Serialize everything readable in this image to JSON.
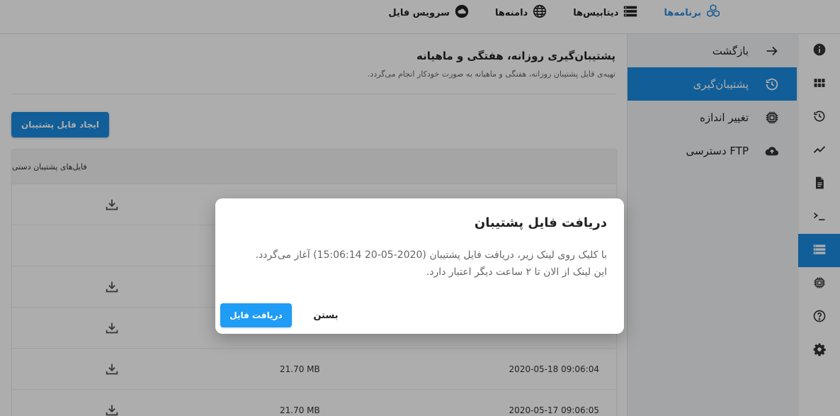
{
  "colors": {
    "accent": "#1a8be0",
    "dialog_button": "#1f9cf5",
    "overlay": "rgba(0,0,0,0.32)"
  },
  "topnav": {
    "items": [
      {
        "label": "برنامه‌ها",
        "icon": "cubes-icon",
        "active": true
      },
      {
        "label": "دیتابیس‌ها",
        "icon": "server-icon",
        "active": false
      },
      {
        "label": "دامنه‌ها",
        "icon": "globe-icon",
        "active": false
      },
      {
        "label": "سرویس فایل",
        "icon": "cloud-icon",
        "active": false
      }
    ]
  },
  "iconbar": {
    "items": [
      {
        "icon": "info-icon"
      },
      {
        "icon": "grid-icon"
      },
      {
        "icon": "history-icon"
      },
      {
        "icon": "chart-line-icon"
      },
      {
        "icon": "file-icon"
      },
      {
        "icon": "terminal-icon"
      },
      {
        "icon": "storage-icon",
        "active": true
      },
      {
        "icon": "chip-icon"
      },
      {
        "icon": "help-icon"
      },
      {
        "icon": "settings-icon"
      }
    ]
  },
  "submenu": {
    "items": [
      {
        "label": "بازگشت",
        "icon": "arrow-right-icon"
      },
      {
        "label": "پشتیبان‌گیری",
        "icon": "history-icon",
        "active": true
      },
      {
        "label": "تغییر اندازه",
        "icon": "chip-icon"
      },
      {
        "label": "دسترسی FTP",
        "icon": "cloud-upload-icon"
      }
    ]
  },
  "main": {
    "title": "پشتیبان‌گیری روزانه، هفتگی و ماهیانه",
    "subtitle": "تهیه‌ی فایل پشتیبان روزانه، هفتگی و ماهیانه به صورت خودکار انجام می‌گردد.",
    "create_button": "ایجاد فایل پشتیبان",
    "table": {
      "header": "فایل‌های پشتیبان دستی",
      "rows": [
        {
          "date": "",
          "size": ""
        },
        {
          "date": "",
          "size": ""
        },
        {
          "date": "",
          "size": ""
        },
        {
          "date": "",
          "size": ""
        },
        {
          "date": "2020-05-18 09:06:04",
          "size": "21.70 MB"
        },
        {
          "date": "2020-05-17 09:06:05",
          "size": "21.70 MB"
        }
      ]
    }
  },
  "dialog": {
    "title": "دریافت فایل پشتیبان",
    "line1": "با کلیک روی لینک زیر، دریافت فایل پشتیبان (2020-05-20 15:06:14) آغاز می‌گردد.",
    "line2": "این لینک از الان تا ۲ ساعت دیگر اعتبار دارد.",
    "primary_button": "دریافت فایل",
    "secondary_button": "بستن"
  }
}
